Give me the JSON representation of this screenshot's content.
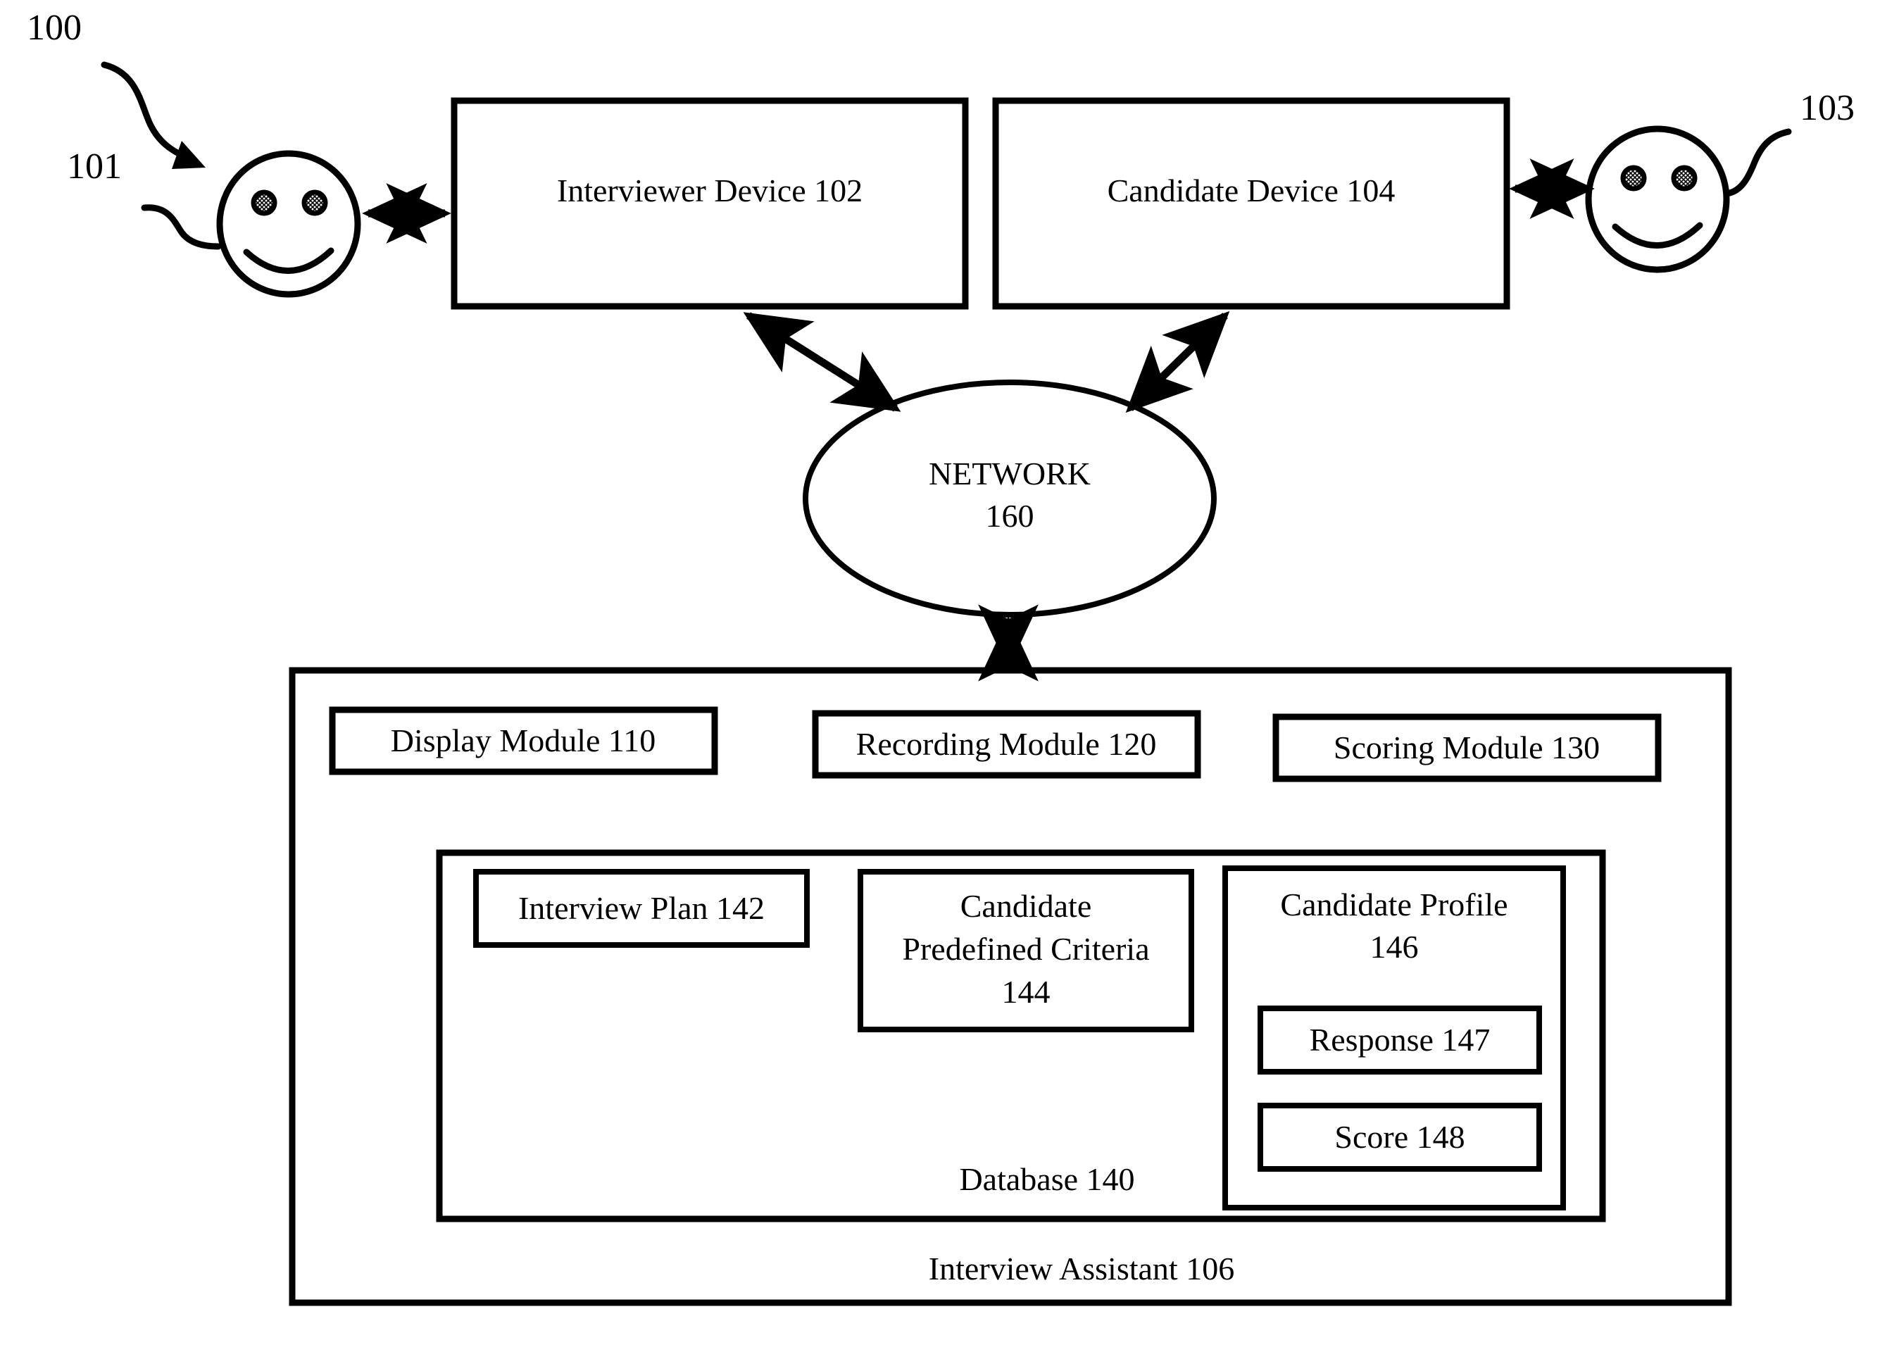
{
  "figure": {
    "figure_number": "100",
    "actors": [
      {
        "ref": "101",
        "name": "interviewer-person"
      },
      {
        "ref": "103",
        "name": "candidate-person"
      }
    ],
    "devices": [
      {
        "label": "Interviewer Device 102"
      },
      {
        "label": "Candidate Device 104"
      }
    ],
    "network": {
      "line1": "NETWORK",
      "line2": "160"
    },
    "assistant": {
      "label": "Interview Assistant 106",
      "modules": [
        {
          "label": "Display Module 110"
        },
        {
          "label": "Recording Module 120"
        },
        {
          "label": "Scoring Module 130"
        }
      ],
      "database": {
        "label": "Database 140",
        "items": [
          {
            "label": "Interview Plan 142"
          },
          {
            "line1": "Candidate",
            "line2": "Predefined Criteria",
            "line3": "144"
          }
        ],
        "candidate_profile": {
          "line1": "Candidate Profile",
          "line2": "146",
          "children": [
            {
              "label": "Response 147"
            },
            {
              "label": "Score 148"
            }
          ]
        }
      }
    },
    "colors": {
      "stroke": "#000000",
      "background": "#ffffff"
    }
  }
}
